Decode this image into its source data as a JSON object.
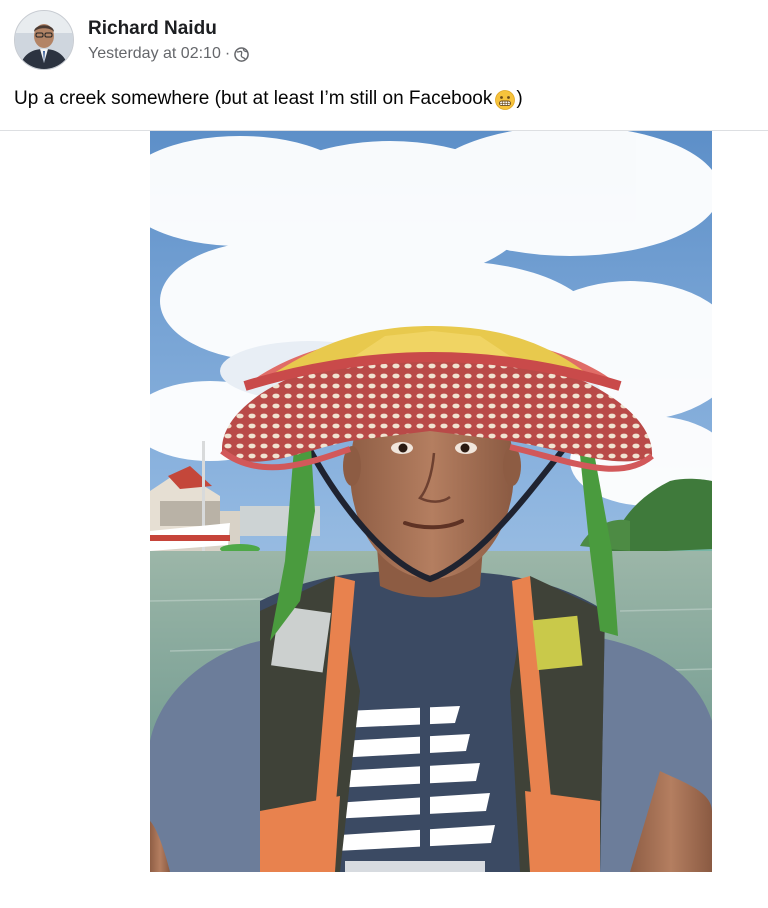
{
  "post": {
    "author_name": "Richard Naidu",
    "timestamp": "Yesterday at 02:10",
    "separator": "·",
    "audience_icon": "globe-icon",
    "caption_text": "Up a creek somewhere (but at least I’m still on Facebook",
    "caption_emoji": "grimacing-face-emoji",
    "caption_close": ")"
  },
  "colors": {
    "author": "#1c1e21",
    "meta": "#65676b",
    "divider": "#dddfe2"
  }
}
